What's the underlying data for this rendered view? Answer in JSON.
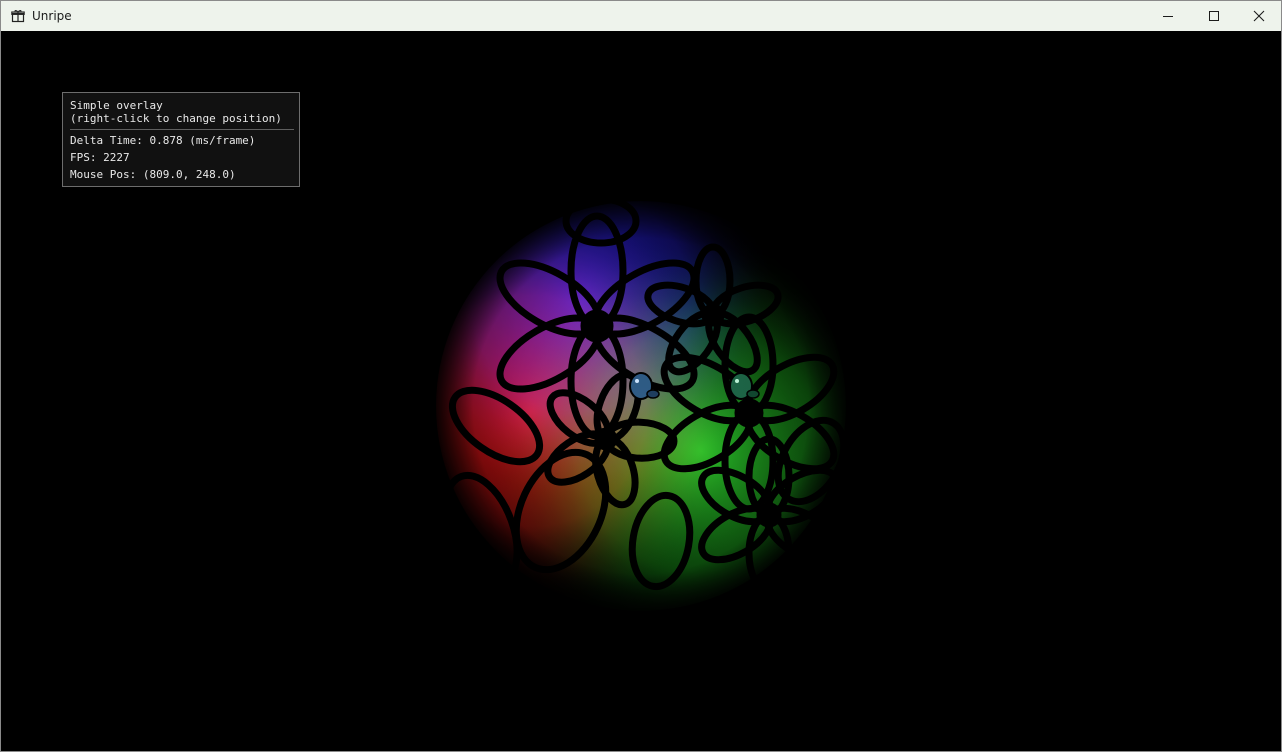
{
  "window": {
    "title": "Unripe",
    "app_icon": "gift-box-icon",
    "controls": {
      "minimize_icon": "minimize-icon",
      "maximize_icon": "maximize-icon",
      "close_icon": "close-icon"
    }
  },
  "overlay": {
    "title": "Simple overlay",
    "hint": "(right-click to change position)",
    "delta_time": "Delta Time: 0.878 (ms/frame)",
    "fps": "FPS: 2227",
    "mouse_pos": "Mouse Pos: (809.0, 248.0)"
  },
  "colors": {
    "background": "#000000",
    "titlebar": "#eef3ec",
    "overlay_bg": "#121212",
    "overlay_border": "#6d6d6d",
    "light_blue": "#1a1aa8",
    "light_red": "#c01010",
    "light_green": "#19b419"
  }
}
